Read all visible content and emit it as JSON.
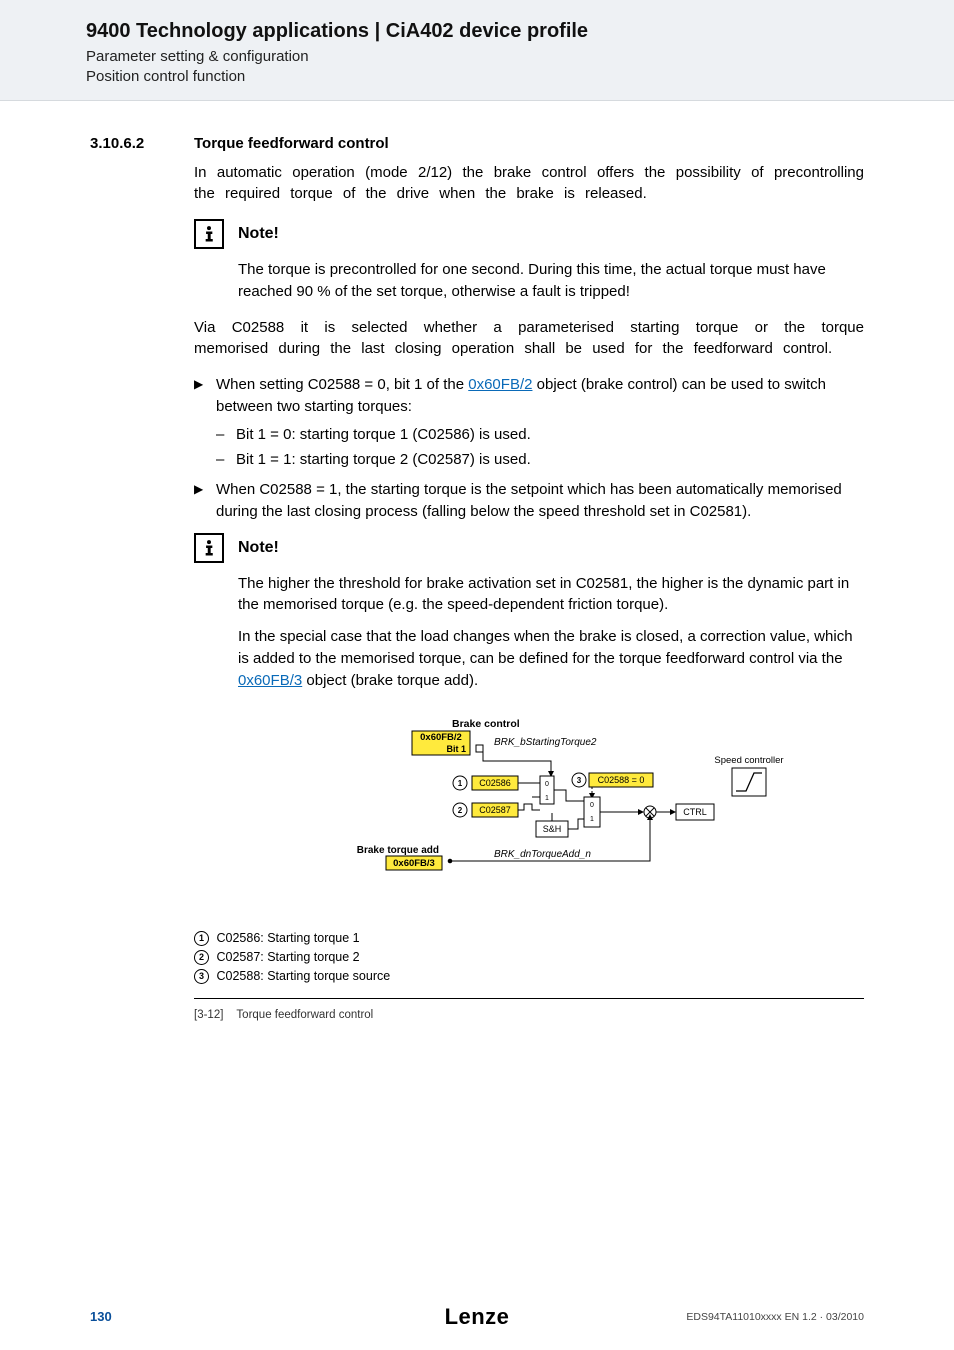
{
  "header": {
    "title": "9400 Technology applications | CiA402 device profile",
    "sub1": "Parameter setting & configuration",
    "sub2": "Position control function"
  },
  "section": {
    "num": "3.10.6.2",
    "title": "Torque feedforward control",
    "para1": "In automatic operation (mode 2/12) the brake control offers the possibility of precontrolling the required torque of the drive when the brake is released."
  },
  "note1": {
    "label": "Note!",
    "text": "The torque is precontrolled for one second. During this time, the actual torque must have reached 90 % of the set torque, otherwise a fault is tripped!"
  },
  "para2": "Via C02588 it is selected whether a parameterised starting torque or the torque memorised during the last closing operation shall be used for the feedforward control.",
  "bullets": {
    "b1_pre": "When setting C02588 = 0, bit 1 of the ",
    "b1_link": "0x60FB/2",
    "b1_post": " object (brake control) can be used to switch between two starting torques:",
    "b1_sub1": "Bit 1 = 0: starting torque 1 (C02586) is used.",
    "b1_sub2": "Bit 1 = 1: starting torque 2 (C02587) is used.",
    "b2": "When C02588 = 1, the starting torque is the setpoint which has been automatically memorised during the last closing process (falling below the speed threshold set in C02581)."
  },
  "note2": {
    "label": "Note!",
    "p1": "The higher the threshold for brake activation set in C02581, the higher is the dynamic part in the memorised torque (e.g. the speed-dependent friction torque).",
    "p2_pre": "In the special case that the load changes when the brake is closed, a correction value, which is added to the memorised torque, can be defined for the torque feedforward control via the ",
    "p2_link": "0x60FB/3",
    "p2_post": " object (brake torque add)."
  },
  "diagram": {
    "brake_control": "Brake control",
    "obj_fb2": "0x60FB/2",
    "bit1": "Bit 1",
    "sig_starttorque2": "BRK_bStartingTorque2",
    "speed_ctrl": "Speed controller",
    "c02586": "C02586",
    "c02587": "C02587",
    "c02588": "C02588 = 0",
    "sh": "S&H",
    "ctrl": "CTRL",
    "zero": "0",
    "one": "1",
    "brake_torque_add": "Brake torque add",
    "obj_fb3": "0x60FB/3",
    "sig_torqueadd": "BRK_dnTorqueAdd_n",
    "legend1": "C02586: Starting torque 1",
    "legend2": "C02587: Starting torque 2",
    "legend3": "C02588: Starting torque source",
    "m1": "1",
    "m2": "2",
    "m3": "3"
  },
  "figure": {
    "num": "[3-12]",
    "caption": "Torque feedforward control"
  },
  "footer": {
    "page": "130",
    "brand": "Lenze",
    "docid": "EDS94TA11010xxxx EN 1.2 · 03/2010"
  }
}
